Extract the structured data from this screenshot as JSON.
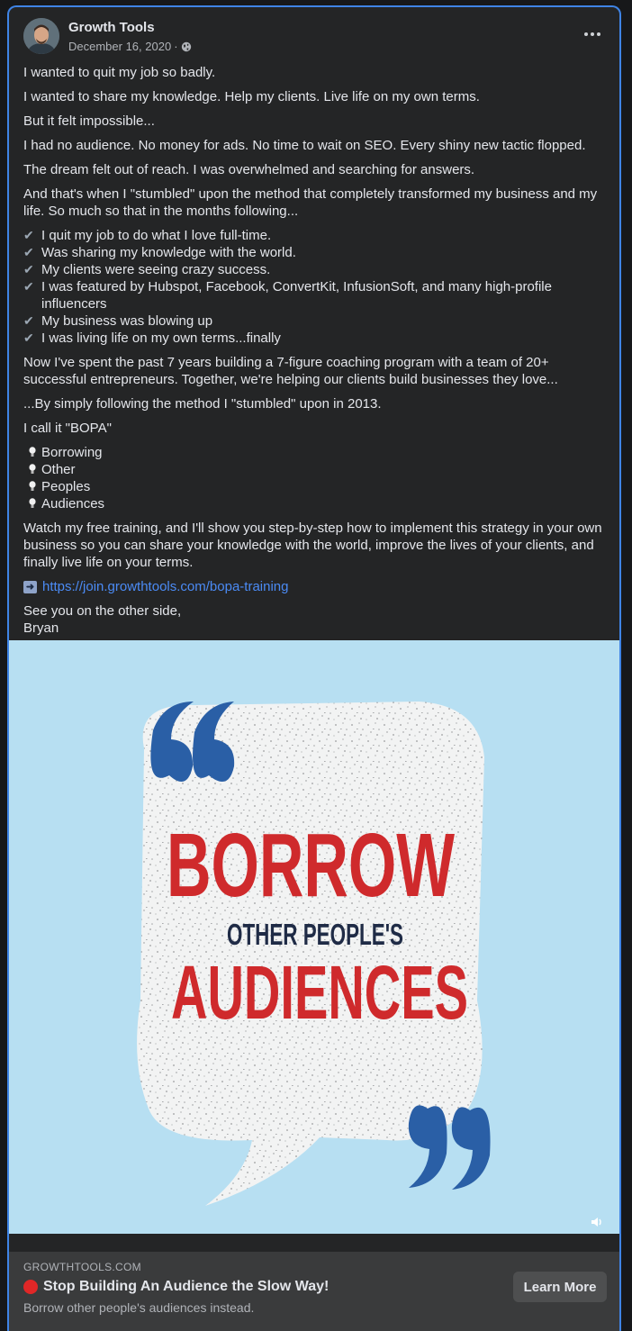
{
  "post": {
    "page_name": "Growth Tools",
    "date": "December 16, 2020",
    "date_separator": "·",
    "privacy_icon": "globe-icon",
    "more_icon": "more-options-icon"
  },
  "content": {
    "p1": "I wanted to quit my job so badly.",
    "p2": "I wanted to share my knowledge. Help my clients. Live life on my own terms.",
    "p3": "But it felt impossible...",
    "p4": "I had no audience. No money for ads. No time to wait on SEO. Every shiny new tactic flopped.",
    "p5": "The dream felt out of reach. I was overwhelmed and searching for answers.",
    "p6": "And that's when I \"stumbled\" upon the method that completely transformed my business and my life. So much so that in the months following...",
    "checklist": [
      "I quit my job to do what I love full-time.",
      "Was sharing my knowledge with the world.",
      "My clients were seeing crazy success.",
      "I was featured by Hubspot, Facebook, ConvertKit, InfusionSoft, and many high-profile influencers",
      "My business was blowing up",
      "I was living life on my own terms...finally"
    ],
    "p7": "Now I've spent the past 7 years building a 7-figure coaching program with a team of 20+ successful entrepreneurs. Together, we're helping our clients build businesses they love...",
    "p8": "...By simply following the method I \"stumbled\" upon in 2013.",
    "p9": "I call it \"BOPA\"",
    "acronym": [
      "Borrowing",
      "Other",
      "Peoples",
      "Audiences"
    ],
    "p10": "Watch my free training, and I'll show you step-by-step how to implement this strategy in your own business so you can share your knowledge with the world, improve the lives of your clients, and finally live life on your terms.",
    "link": "https://join.growthtools.com/bopa-training",
    "signoff_1": "See you on the other side,",
    "signoff_2": "Bryan"
  },
  "image": {
    "line1": "BORROW",
    "line2": "OTHER PEOPLE'S",
    "line3": "AUDIENCES",
    "colors": {
      "background": "#b7dff2",
      "bubble": "#f3f4f4",
      "quote": "#2a5fa6",
      "red_text": "#cf2a2c",
      "navy_text": "#1f2b46"
    }
  },
  "cta": {
    "domain": "GROWTHTOOLS.COM",
    "title": "Stop Building An Audience the Slow Way!",
    "description": "Borrow other people's audiences instead.",
    "button": "Learn More"
  }
}
